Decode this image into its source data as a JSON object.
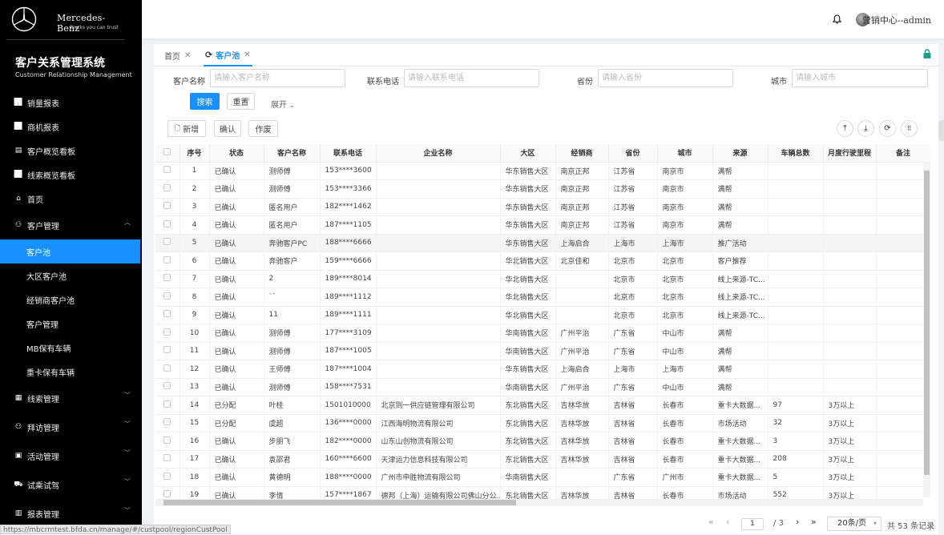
{
  "brand": {
    "name": "Mercedes-Benz",
    "tagline": "Trucks you can trust",
    "system_title": "客户关系管理系统",
    "system_subtitle": "Customer Relationship Management"
  },
  "menu": [
    {
      "label": "销量报表",
      "icon": "bar-chart-icon",
      "type": "item"
    },
    {
      "label": "商机报表",
      "icon": "line-chart-icon",
      "type": "item"
    },
    {
      "label": "客户概览看板",
      "icon": "dashboard-icon",
      "type": "item"
    },
    {
      "label": "线索概览看板",
      "icon": "trend-icon",
      "type": "item"
    },
    {
      "label": "首页",
      "icon": "home-icon",
      "type": "item"
    },
    {
      "label": "客户管理",
      "icon": "user-icon",
      "type": "group",
      "arrow": "up"
    },
    {
      "label": "客户池",
      "type": "sub",
      "active": true
    },
    {
      "label": "大区客户池",
      "type": "sub"
    },
    {
      "label": "经销商客户池",
      "type": "sub"
    },
    {
      "label": "客户管理",
      "type": "sub"
    },
    {
      "label": "MB保有车辆",
      "type": "sub"
    },
    {
      "label": "重卡保有车辆",
      "type": "sub"
    },
    {
      "label": "线索管理",
      "icon": "doc-icon",
      "type": "group",
      "arrow": "down"
    },
    {
      "label": "拜访管理",
      "icon": "user-icon",
      "type": "group",
      "arrow": "down"
    },
    {
      "label": "活动管理",
      "icon": "calendar-icon",
      "type": "group",
      "arrow": "down"
    },
    {
      "label": "试乘试驾",
      "icon": "car-icon",
      "type": "group",
      "arrow": "down"
    },
    {
      "label": "报表管理",
      "icon": "report-icon",
      "type": "group",
      "arrow": "down"
    }
  ],
  "header": {
    "user": "营销中心--admin"
  },
  "tabs": [
    {
      "label": "首页"
    },
    {
      "label": "客户池"
    }
  ],
  "filters": {
    "name_label": "客户名称",
    "name_placeholder": "请输入客户名称",
    "phone_label": "联系电话",
    "phone_placeholder": "请输入联系电话",
    "province_label": "省份",
    "province_placeholder": "请输入省份",
    "city_label": "城市",
    "city_placeholder": "请输入城市",
    "search": "搜索",
    "reset": "重置",
    "expand": "展开"
  },
  "actions": {
    "add": "新增",
    "confirm": "确认",
    "void": "作废"
  },
  "columns": [
    "序号",
    "状态",
    "客户名称",
    "联系电话",
    "企业名称",
    "大区",
    "经销商",
    "省份",
    "城市",
    "来源",
    "车辆总数",
    "月度行驶里程",
    "备注"
  ],
  "rows": [
    [
      "1",
      "已确认",
      "测师傅",
      "153****3600",
      "",
      "华东销售大区",
      "南京正邦",
      "江苏省",
      "南京市",
      "满帮",
      "",
      "",
      ""
    ],
    [
      "2",
      "已确认",
      "测师傅",
      "153****3366",
      "",
      "华东销售大区",
      "南京正邦",
      "江苏省",
      "南京市",
      "满帮",
      "",
      "",
      ""
    ],
    [
      "3",
      "已确认",
      "匿名用户",
      "182****1462",
      "",
      "华东销售大区",
      "南京正邦",
      "江苏省",
      "南京市",
      "满帮",
      "",
      "",
      ""
    ],
    [
      "4",
      "已确认",
      "匿名用户",
      "187****1105",
      "",
      "华东销售大区",
      "南京正邦",
      "江苏省",
      "南京市",
      "满帮",
      "",
      "",
      ""
    ],
    [
      "5",
      "已确认",
      "奔驰客户PC",
      "188****6666",
      "",
      "华东销售大区",
      "上海启合",
      "上海市",
      "上海市",
      "推广活动",
      "",
      "",
      ""
    ],
    [
      "6",
      "已确认",
      "奔驰客户",
      "159****6666",
      "",
      "华北销售大区",
      "北京佳和",
      "北京市",
      "北京市",
      "客户推荐",
      "",
      "",
      ""
    ],
    [
      "7",
      "已确认",
      "2",
      "189****8014",
      "",
      "华北销售大区",
      "",
      "北京市",
      "北京市",
      "线上来源-TC...",
      "",
      "",
      ""
    ],
    [
      "8",
      "已确认",
      "``",
      "189****1112",
      "",
      "华北销售大区",
      "",
      "北京市",
      "北京市",
      "线上来源-TC...",
      "",
      "",
      ""
    ],
    [
      "9",
      "已确认",
      "11",
      "189****1111",
      "",
      "华北销售大区",
      "",
      "北京市",
      "北京市",
      "线上来源-TC...",
      "",
      "",
      ""
    ],
    [
      "10",
      "已确认",
      "测师傅",
      "177****3109",
      "",
      "华南销售大区",
      "广州平治",
      "广东省",
      "中山市",
      "满帮",
      "",
      "",
      ""
    ],
    [
      "11",
      "已确认",
      "测师傅",
      "187****1005",
      "",
      "华南销售大区",
      "广州平治",
      "广东省",
      "中山市",
      "满帮",
      "",
      "",
      ""
    ],
    [
      "12",
      "已确认",
      "王师傅",
      "187****1004",
      "",
      "华东销售大区",
      "上海启合",
      "上海市",
      "上海市",
      "满帮",
      "",
      "",
      ""
    ],
    [
      "13",
      "已确认",
      "测师傅",
      "158****7531",
      "",
      "华南销售大区",
      "广州平治",
      "广东省",
      "中山市",
      "满帮",
      "",
      "",
      ""
    ],
    [
      "14",
      "已分配",
      "叶桂",
      "1501010000",
      "北京则一供应链管理有限公司",
      "东北销售大区",
      "吉林华放",
      "吉林省",
      "长春市",
      "重卡大数据...",
      "97",
      "3万以上",
      ""
    ],
    [
      "15",
      "已分配",
      "虞超",
      "136****0000",
      "江西海明物流有限公司",
      "东北销售大区",
      "吉林华放",
      "吉林省",
      "长春市",
      "市场活动",
      "32",
      "3万以上",
      ""
    ],
    [
      "16",
      "已确认",
      "步朋飞",
      "182****0000",
      "山东山创物流有限公司",
      "东北销售大区",
      "吉林华放",
      "吉林省",
      "长春市",
      "重卡大数据...",
      "3",
      "3万以上",
      ""
    ],
    [
      "17",
      "已确认",
      "袁邵君",
      "160****6600",
      "天津运力信息科技有限公司",
      "东北销售大区",
      "吉林华放",
      "吉林省",
      "长春市",
      "重卡大数据...",
      "208",
      "3万以上",
      ""
    ],
    [
      "18",
      "已确认",
      "黄德明",
      "188****0000",
      "广州市申胜物流有限公司",
      "华南销售大区",
      "",
      "广东省",
      "广州市",
      "重卡大数据...",
      "5",
      "3万以上",
      ""
    ],
    [
      "19",
      "已确认",
      "李倩",
      "157****1867",
      "德邦（上海）运输有限公司佛山分公...",
      "东北销售大区",
      "吉林华放",
      "吉林省",
      "长春市",
      "市场活动",
      "552",
      "3万以上",
      ""
    ]
  ],
  "pagination": {
    "current": "1",
    "total_pages": "/ 3",
    "page_size": "20条/页",
    "total": "共 53 条记录"
  },
  "status_url": "https://mbcrmtest.bfda.cn/manage/#/custpool/regionCustPool"
}
